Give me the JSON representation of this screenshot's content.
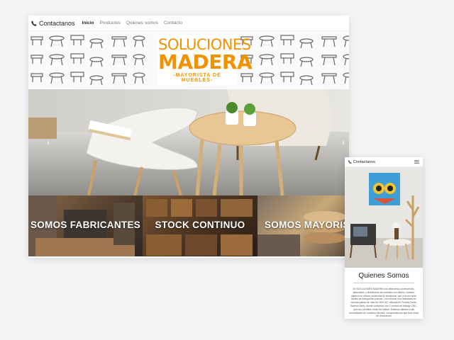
{
  "desktop": {
    "nav": {
      "phone_label": "Contactanos",
      "links": [
        "Inicio",
        "Productos",
        "Quienes somos",
        "Contacto"
      ],
      "active_index": 0
    },
    "logo": {
      "line1": "SOLUCIONES",
      "line2": "MADERA",
      "line3": "-MAYORISTA DE MUEBLES-"
    },
    "hero": {
      "prev_arrow": "‹",
      "next_arrow": "›"
    },
    "tiles": [
      "SOMOS FABRICANTES",
      "STOCK CONTINUO",
      "SOMOS MAYORISTAS"
    ]
  },
  "mobile": {
    "nav": {
      "phone_label": "Contactanos"
    },
    "title": "Quienes Somos",
    "body": "En SOLUCIONES MADERA nos dedicamos al desarrollo, fabricación y distribución de muebles con diseño. Nuestro objetivo es ofrecer productos de tendencia, que a la vez sean fáciles de transportar y armar. Los mismos son realizados en nuestra planta de más de 1500 m2, ubicada en Florida Oeste, Buenos Aires, donde contamos con 2 centros de trabajo CNC, que nos permiten crear los límites. Estamos atentos a las necesidades de nuestros clientes, comprendiendo que todo local de decoración"
  },
  "colors": {
    "brand_orange": "#f39200",
    "text_dark": "#222222"
  }
}
